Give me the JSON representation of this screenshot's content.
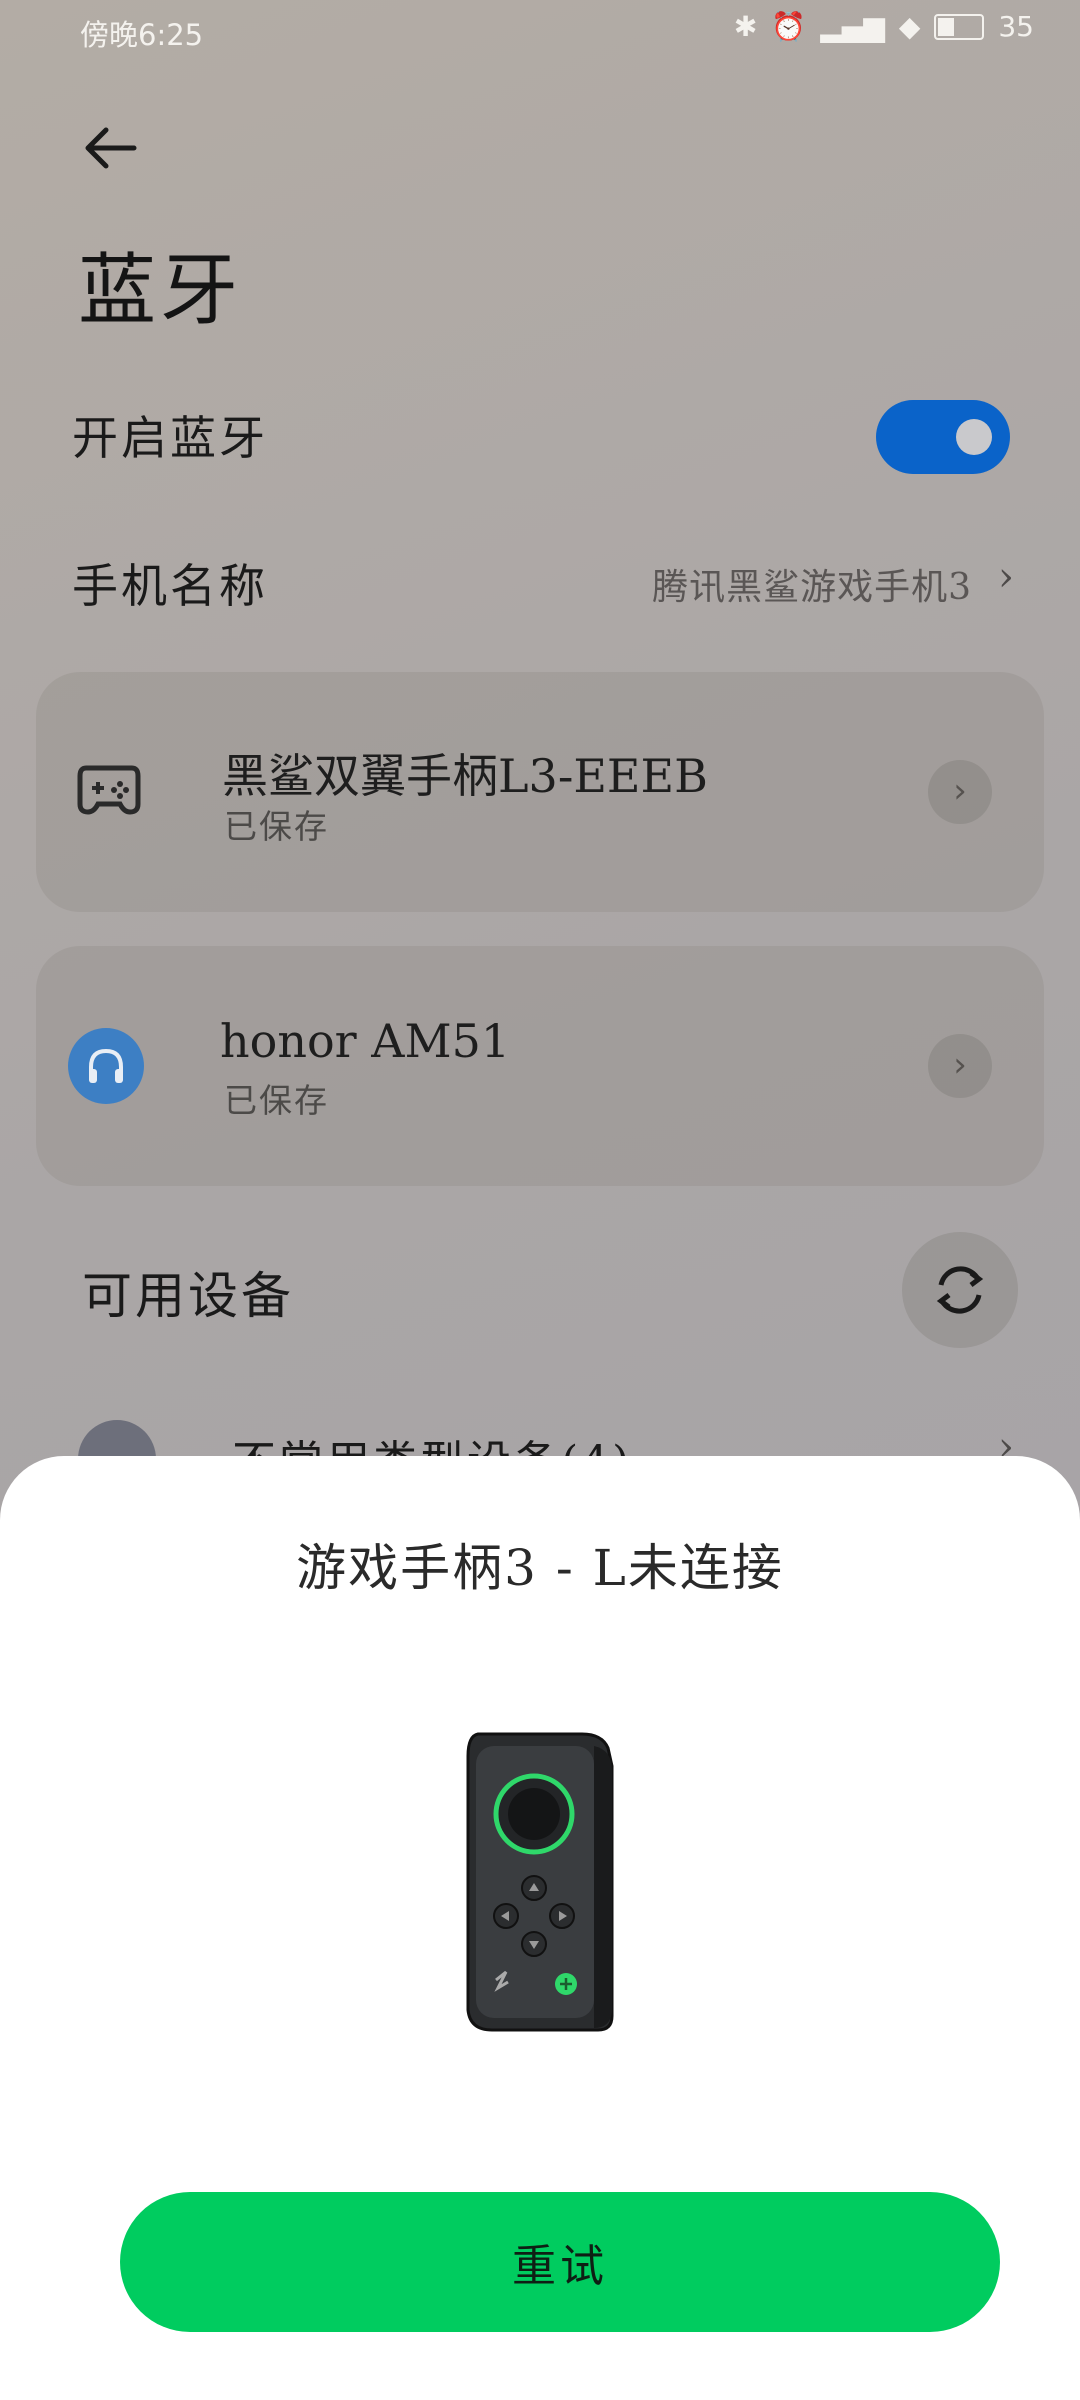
{
  "status_bar": {
    "time": "傍晚6:25",
    "battery": "35"
  },
  "header": {
    "title": "蓝牙"
  },
  "bluetooth_toggle": {
    "label": "开启蓝牙",
    "on": true
  },
  "phone_name": {
    "label": "手机名称",
    "value": "腾讯黑鲨游戏手机3"
  },
  "saved_devices": [
    {
      "name": "黑鲨双翼手柄L3-EEEB",
      "status": "已保存",
      "icon": "gamepad-icon"
    },
    {
      "name": "honor AM51",
      "status": "已保存",
      "icon": "headphones-icon"
    }
  ],
  "available_devices": {
    "label": "可用设备",
    "item_label": "不常用类型设备(4)"
  },
  "dialog": {
    "title": "游戏手柄3 - L未连接",
    "retry_label": "重试"
  },
  "colors": {
    "toggle_on": "#0a63c9",
    "retry_button": "#00cc5f",
    "headphone_badge": "#3d7fc4"
  }
}
